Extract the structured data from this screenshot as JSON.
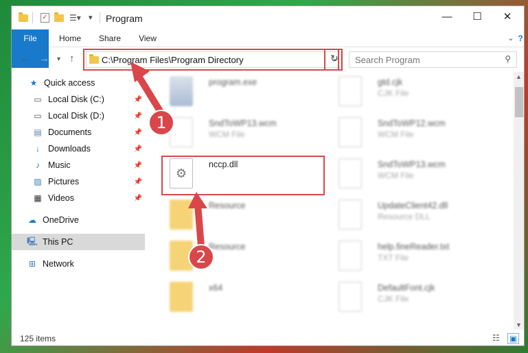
{
  "window": {
    "title": "Program"
  },
  "ribbon": {
    "tabs": [
      "File",
      "Home",
      "Share",
      "View"
    ]
  },
  "address": {
    "path": "C:\\Program Files\\Program Directory"
  },
  "search": {
    "placeholder": "Search Program"
  },
  "sidebar": {
    "items": [
      {
        "label": "Quick access",
        "icon": "star-icon",
        "pinned": false
      },
      {
        "label": "Local Disk (C:)",
        "icon": "drive-icon",
        "pinned": true
      },
      {
        "label": "Local Disk (D:)",
        "icon": "drive-icon",
        "pinned": true
      },
      {
        "label": "Documents",
        "icon": "documents-icon",
        "pinned": true
      },
      {
        "label": "Downloads",
        "icon": "download-icon",
        "pinned": true
      },
      {
        "label": "Music",
        "icon": "music-icon",
        "pinned": true
      },
      {
        "label": "Pictures",
        "icon": "pictures-icon",
        "pinned": true
      },
      {
        "label": "Videos",
        "icon": "videos-icon",
        "pinned": true
      },
      {
        "label": "OneDrive",
        "icon": "cloud-icon",
        "pinned": false
      },
      {
        "label": "This PC",
        "icon": "computer-icon",
        "pinned": false
      },
      {
        "label": "Network",
        "icon": "network-icon",
        "pinned": false
      }
    ]
  },
  "files": {
    "left": [
      {
        "name": "program.exe",
        "type": ""
      },
      {
        "name": "SndToWP13.wcm",
        "type": "WCM File"
      },
      {
        "name": "nccp.dll",
        "type": ""
      },
      {
        "name": "Resource",
        "type": ""
      },
      {
        "name": "Resource",
        "type": ""
      },
      {
        "name": "x64",
        "type": ""
      }
    ],
    "right": [
      {
        "name": "gtd.cjk",
        "type": "CJK File"
      },
      {
        "name": "SndToWP12.wcm",
        "type": "WCM File"
      },
      {
        "name": "SndToWP13.wcm",
        "type": "WCM File"
      },
      {
        "name": "UpdateClient42.dll",
        "type": "Resource DLL"
      },
      {
        "name": "help.fineReader.txt",
        "type": "TXT File"
      },
      {
        "name": "DefaultFont.cjk",
        "type": "CJK File"
      }
    ]
  },
  "status": {
    "count": "125 items"
  },
  "callouts": [
    "1",
    "2"
  ],
  "colors": {
    "accent": "#1979ca",
    "highlight": "#d9474a",
    "selected": "#d9d9d9"
  }
}
